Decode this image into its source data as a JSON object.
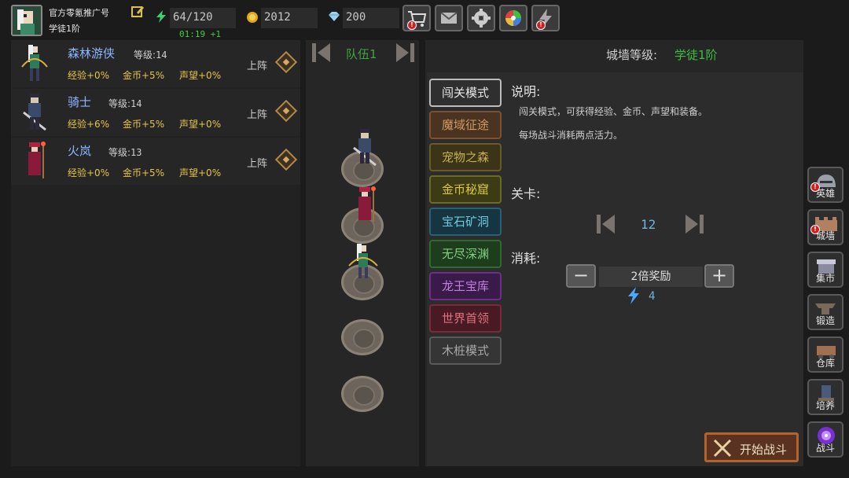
{
  "player": {
    "name": "官方零氪推广号",
    "rank": "学徒1阶",
    "avatar_icon": "hero-portrait-icon"
  },
  "stats": {
    "energy": "64/120",
    "gold": "2012",
    "gems": "200",
    "regen_timer": "01:19 +1"
  },
  "toolbar": [
    {
      "name": "shop-cart-icon",
      "alert": "!"
    },
    {
      "name": "mail-icon",
      "alert": ""
    },
    {
      "name": "settings-icon",
      "alert": ""
    },
    {
      "name": "gacha-wheel-icon",
      "alert": ""
    },
    {
      "name": "lightning-icon",
      "alert": "!"
    }
  ],
  "heroes": [
    {
      "name": "森林游侠",
      "level_label": "等级:",
      "level": "14",
      "deploy": "上阵",
      "bonus": [
        "经验+0%",
        "金币+5%",
        "声望+0%"
      ]
    },
    {
      "name": "骑士",
      "level_label": "等级:",
      "level": "14",
      "deploy": "上阵",
      "bonus": [
        "经验+6%",
        "金币+5%",
        "声望+0%"
      ]
    },
    {
      "name": "火岚",
      "level_label": "等级:",
      "level": "13",
      "deploy": "上阵",
      "bonus": [
        "经验+0%",
        "金币+5%",
        "声望+0%"
      ]
    }
  ],
  "team": {
    "label": "队伍1"
  },
  "wall": {
    "label": "城墙等级:",
    "value": "学徒1阶"
  },
  "modes": [
    {
      "label": "闯关模式",
      "bg": "#2f2f2f",
      "border": "#bcbcbc",
      "color": "#e8e8e8"
    },
    {
      "label": "魔域征途",
      "bg": "#4a3320",
      "border": "#7a5230",
      "color": "#d09a60"
    },
    {
      "label": "宠物之森",
      "bg": "#3c3418",
      "border": "#6a5a28",
      "color": "#c8b050"
    },
    {
      "label": "金币秘窟",
      "bg": "#3d3b16",
      "border": "#6c6a24",
      "color": "#d8c840"
    },
    {
      "label": "宝石矿洞",
      "bg": "#173540",
      "border": "#2b6070",
      "color": "#6ec8e0"
    },
    {
      "label": "无尽深渊",
      "bg": "#1d3d1d",
      "border": "#2f6a2f",
      "color": "#7fd07f"
    },
    {
      "label": "龙王宝库",
      "bg": "#3a1a48",
      "border": "#6a3082",
      "color": "#c080e0"
    },
    {
      "label": "世界首领",
      "bg": "#481a24",
      "border": "#7a2a3a",
      "color": "#e07080"
    },
    {
      "label": "木桩模式",
      "bg": "#353535",
      "border": "#5a5a5a",
      "color": "#a8a8a8"
    }
  ],
  "detail": {
    "desc_title": "说明:",
    "desc_lines": [
      "闯关模式，可获得经验、金币、声望和装备。",
      "每场战斗消耗两点活力。"
    ],
    "stage_label": "关卡:",
    "stage": "12",
    "cost_label": "消耗:",
    "reward_option": "2倍奖励",
    "energy_cost": "4"
  },
  "side_nav": [
    {
      "label": "英雄",
      "icon": "helmet-icon",
      "alert": "!"
    },
    {
      "label": "城墙",
      "icon": "castle-wall-icon",
      "alert": "!"
    },
    {
      "label": "集市",
      "icon": "market-stall-icon",
      "alert": ""
    },
    {
      "label": "锻造",
      "icon": "anvil-icon",
      "alert": ""
    },
    {
      "label": "仓库",
      "icon": "storage-cart-icon",
      "alert": ""
    },
    {
      "label": "培养",
      "icon": "training-statue-icon",
      "alert": ""
    },
    {
      "label": "战斗",
      "icon": "portal-icon",
      "alert": ""
    }
  ],
  "start_button": "开始战斗",
  "colors": {
    "accent_green": "#3fbf3f",
    "hero_name": "#8cb6ff",
    "bonus": "#e6c44a",
    "stage_blue": "#6ab4e6"
  }
}
